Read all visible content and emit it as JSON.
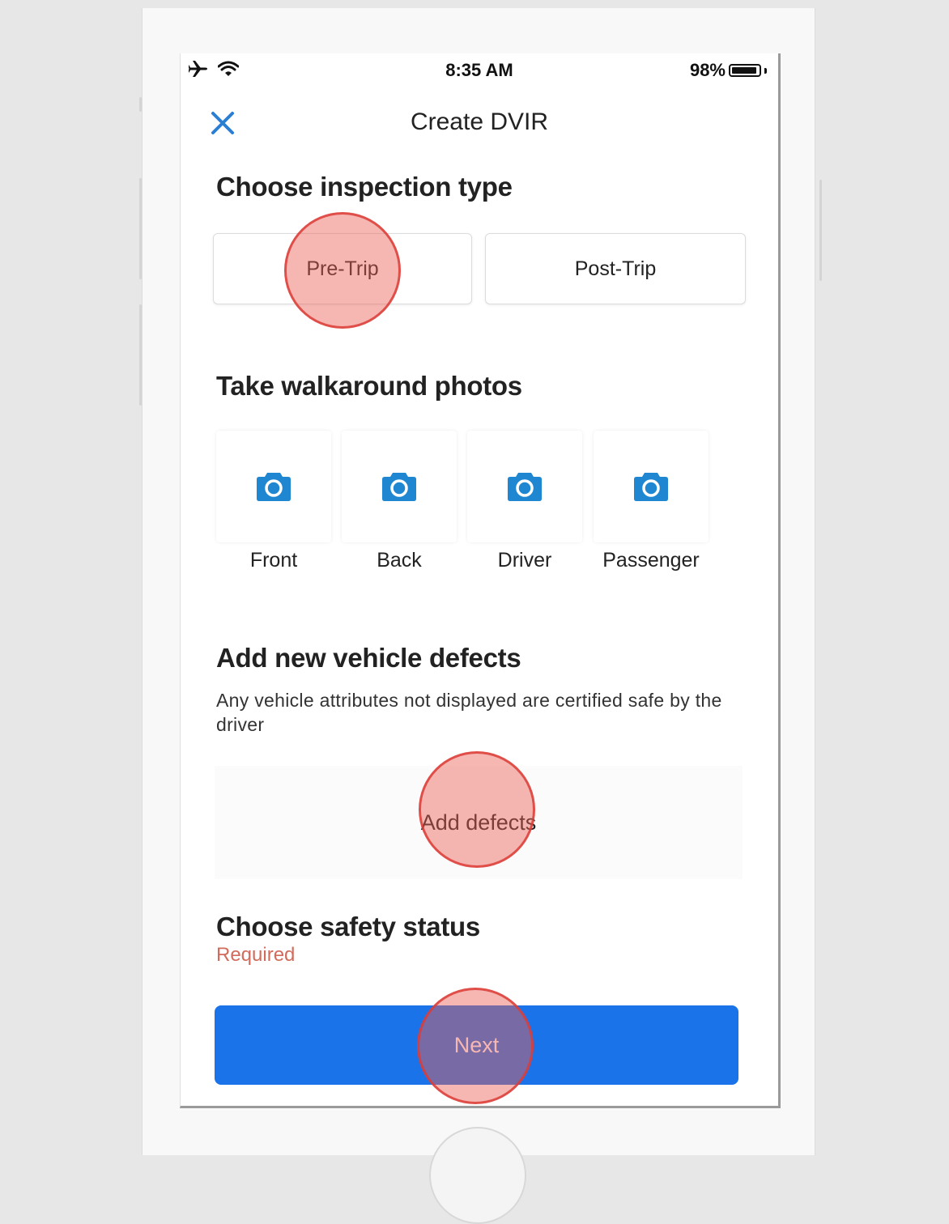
{
  "status_bar": {
    "airplane_icon": "airplane-icon",
    "wifi_icon": "wifi-icon",
    "time": "8:35 AM",
    "battery_percent": "98%",
    "battery_level": 0.98
  },
  "nav": {
    "close_icon": "close-icon",
    "title": "Create DVIR"
  },
  "inspection_type": {
    "title": "Choose inspection type",
    "options": [
      "Pre-Trip",
      "Post-Trip"
    ]
  },
  "walkaround": {
    "title": "Take walkaround photos",
    "photos": [
      {
        "label": "Front",
        "icon": "camera-icon"
      },
      {
        "label": "Back",
        "icon": "camera-icon"
      },
      {
        "label": "Driver",
        "icon": "camera-icon"
      },
      {
        "label": "Passenger",
        "icon": "camera-icon"
      }
    ]
  },
  "defects": {
    "title": "Add new vehicle defects",
    "description": "Any vehicle attributes not displayed are certified safe by the driver",
    "button_label": "Add defects"
  },
  "safety": {
    "title": "Choose safety status",
    "required_label": "Required"
  },
  "footer": {
    "next_label": "Next"
  },
  "colors": {
    "accent": "#1a73e8",
    "close_icon": "#2a7fd4",
    "camera_icon": "#1f86d1",
    "required": "#d26b5b",
    "tap_marker": "#eb5f55"
  },
  "tap_markers": [
    "Pre-Trip",
    "Add defects",
    "Next"
  ]
}
